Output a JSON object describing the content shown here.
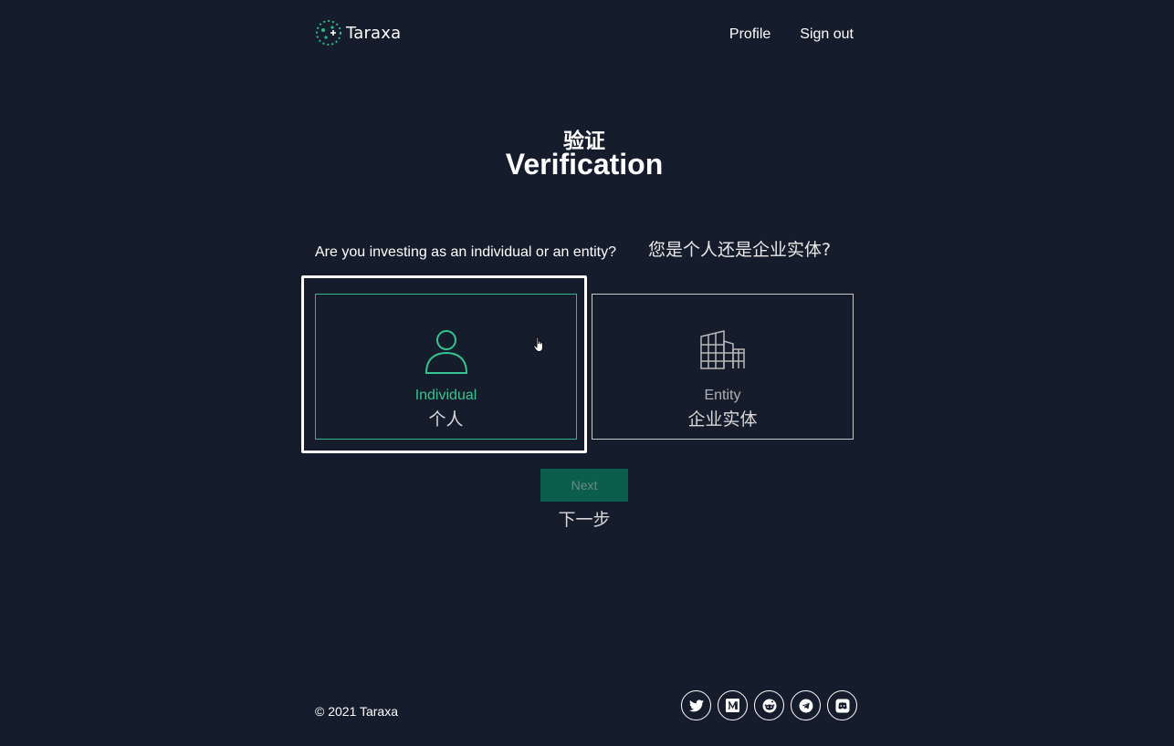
{
  "header": {
    "logo_text": "Taraxa",
    "nav": {
      "profile": "Profile",
      "signout": "Sign out"
    }
  },
  "page": {
    "title_cn": "验证",
    "title_en": "Verification",
    "question_en": "Are you investing as an individual or an entity?",
    "question_cn": "您是个人还是企业实体?"
  },
  "options": {
    "individual": {
      "label_en": "Individual",
      "label_cn": "个人",
      "icon": "person-icon",
      "selected": true
    },
    "entity": {
      "label_en": "Entity",
      "label_cn": "企业实体",
      "icon": "building-icon",
      "selected": false
    }
  },
  "actions": {
    "next_label": "Next",
    "next_label_cn": "下一步",
    "next_disabled": true
  },
  "footer": {
    "copyright": "© 2021 Taraxa",
    "social": [
      "twitter-icon",
      "medium-icon",
      "reddit-icon",
      "telegram-icon",
      "discord-icon"
    ]
  },
  "colors": {
    "background": "#151c2c",
    "accent": "#35c48f",
    "button_bg": "#0b5e4e"
  }
}
